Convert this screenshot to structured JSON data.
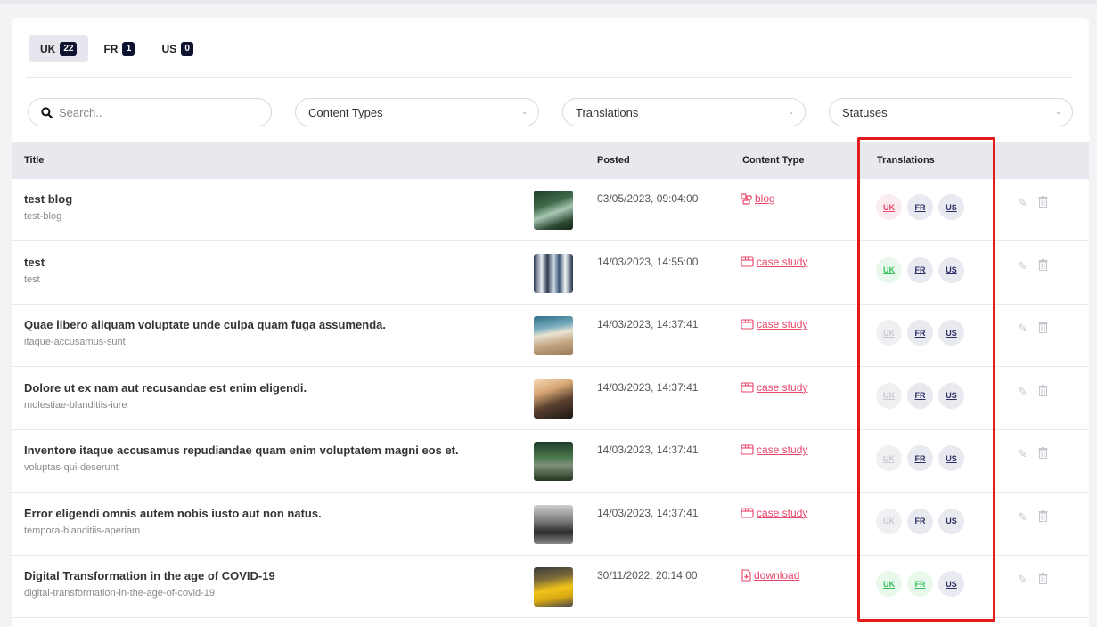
{
  "locales": [
    {
      "code": "UK",
      "count": "22",
      "active": true
    },
    {
      "code": "FR",
      "count": "1",
      "active": false
    },
    {
      "code": "US",
      "count": "0",
      "active": false
    }
  ],
  "filters": {
    "search_placeholder": "Search..",
    "content_types": "Content Types",
    "translations": "Translations",
    "statuses": "Statuses"
  },
  "table": {
    "headers": {
      "title": "Title",
      "posted": "Posted",
      "content_type": "Content Type",
      "translations": "Translations"
    },
    "rows": [
      {
        "title": "test blog",
        "slug": "test-blog",
        "posted": "03/05/2023, 09:04:00",
        "type": "blog",
        "type_icon": "blog-icon",
        "trans": [
          "draft",
          "en",
          "en"
        ],
        "thumb": "forest"
      },
      {
        "title": "test",
        "slug": "test",
        "posted": "14/03/2023, 14:55:00",
        "type": "case study",
        "type_icon": "case-study-icon",
        "trans": [
          "pub",
          "en",
          "en"
        ],
        "thumb": "office"
      },
      {
        "title": "Quae libero aliquam voluptate unde culpa quam fuga assumenda.",
        "slug": "itaque-accusamus-sunt",
        "posted": "14/03/2023, 14:37:41",
        "type": "case study",
        "type_icon": "case-study-icon",
        "trans": [
          "none",
          "en",
          "en"
        ],
        "thumb": "beach"
      },
      {
        "title": "Dolore ut ex nam aut recusandae est enim eligendi.",
        "slug": "molestiae-blanditiis-iure",
        "posted": "14/03/2023, 14:37:41",
        "type": "case study",
        "type_icon": "case-study-icon",
        "trans": [
          "none",
          "en",
          "en"
        ],
        "thumb": "mountain"
      },
      {
        "title": "Inventore itaque accusamus repudiandae quam enim voluptatem magni eos et.",
        "slug": "voluptas-qui-deserunt",
        "posted": "14/03/2023, 14:37:41",
        "type": "case study",
        "type_icon": "case-study-icon",
        "trans": [
          "none",
          "en",
          "en"
        ],
        "thumb": "bridge"
      },
      {
        "title": "Error eligendi omnis autem nobis iusto aut non natus.",
        "slug": "tempora-blanditiis-aperiam",
        "posted": "14/03/2023, 14:37:41",
        "type": "case study",
        "type_icon": "case-study-icon",
        "trans": [
          "none",
          "en",
          "en"
        ],
        "thumb": "city"
      },
      {
        "title": "Digital Transformation in the age of COVID-19",
        "slug": "digital-transformation-in-the-age-of-covid-19",
        "posted": "30/11/2022, 20:14:00",
        "type": "download",
        "type_icon": "download-icon",
        "trans": [
          "pub",
          "pub",
          "en"
        ],
        "thumb": "taxi"
      }
    ],
    "badge_labels": [
      "UK",
      "FR",
      "US"
    ]
  },
  "colors": {
    "accent": "#e8466a",
    "published": "#38c25b",
    "highlight": "#e21b1b",
    "locale_badge": "#0e1330"
  }
}
